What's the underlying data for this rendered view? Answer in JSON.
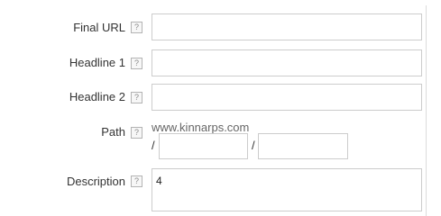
{
  "form": {
    "final_url": {
      "label": "Final URL",
      "help": "?",
      "value": ""
    },
    "headline1": {
      "label": "Headline 1",
      "help": "?",
      "value": ""
    },
    "headline2": {
      "label": "Headline 2",
      "help": "?",
      "value": ""
    },
    "path": {
      "label": "Path",
      "help": "?",
      "domain": "www.kinnarps.com",
      "separator": "/",
      "path1_value": "",
      "path2_value": ""
    },
    "description": {
      "label": "Description",
      "help": "?",
      "value": "4"
    }
  }
}
